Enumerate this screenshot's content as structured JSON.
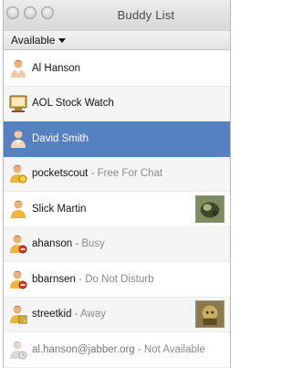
{
  "window": {
    "title": "Buddy List"
  },
  "statusbar": {
    "status": "Available"
  },
  "buddies": [
    {
      "name": "Al Hanson",
      "status": "",
      "icon": "person-icon"
    },
    {
      "name": "AOL Stock Watch",
      "status": "",
      "icon": "computer-icon"
    },
    {
      "name": "David Smith",
      "status": "",
      "icon": "person-icon"
    },
    {
      "name": "pocketscout",
      "status": " - Free For Chat",
      "icon": "person-free-icon"
    },
    {
      "name": "Slick Martin",
      "status": "",
      "icon": "person-icon"
    },
    {
      "name": "ahanson",
      "status": " - Busy",
      "icon": "person-busy-icon"
    },
    {
      "name": "bbarnsen",
      "status": " - Do Not Disturb",
      "icon": "person-dnd-icon"
    },
    {
      "name": "streetkid",
      "status": " - Away",
      "icon": "person-away-icon"
    },
    {
      "name": "al.hanson@jabber.org",
      "status": " - Not Available",
      "icon": "person-na-icon"
    }
  ],
  "colors": {
    "selection": "#5681c0"
  }
}
